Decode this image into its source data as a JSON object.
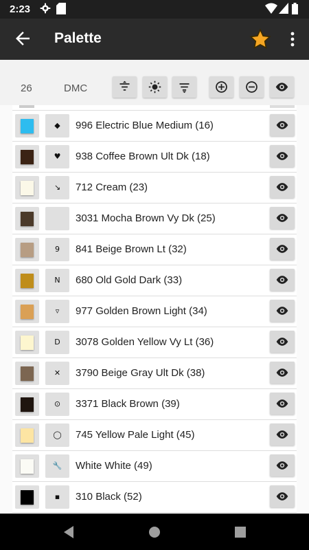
{
  "status_bar": {
    "time": "2:23",
    "icons": [
      "gear-icon",
      "sd-card-icon",
      "wifi-icon",
      "signal-icon",
      "battery-icon"
    ]
  },
  "app_bar": {
    "title": "Palette",
    "icons": [
      "back-arrow-icon",
      "star-icon",
      "more-vert-icon"
    ],
    "colors": {
      "background": "#2b2b2b",
      "star": "#f5a623"
    }
  },
  "toolbar": {
    "count": "26",
    "brand": "DMC",
    "buttons": [
      "sort-icon",
      "brightness-icon",
      "filter-icon",
      "zoom-in-icon",
      "zoom-out-icon",
      "eye-icon"
    ]
  },
  "colors": [
    {
      "swatch": "#2ebcef",
      "symbol": "◆",
      "label": "996 Electric Blue Medium",
      "count": "(16)"
    },
    {
      "swatch": "#3b2314",
      "symbol": "♥",
      "label": "938 Coffee Brown Ult Dk",
      "count": "(18)"
    },
    {
      "swatch": "#fbf8e8",
      "symbol": "↘",
      "label": "712 Cream",
      "count": "(23)"
    },
    {
      "swatch": "#4b3a2a",
      "symbol": "",
      "label": "3031 Mocha Brown Vy Dk",
      "count": "(25)"
    },
    {
      "swatch": "#b79d83",
      "symbol": "9",
      "label": "841 Beige Brown Lt",
      "count": "(32)"
    },
    {
      "swatch": "#bf8d1a",
      "symbol": "N",
      "label": "680 Old Gold Dark",
      "count": "(33)"
    },
    {
      "swatch": "#daa055",
      "symbol": "▿",
      "label": "977 Golden Brown Light",
      "count": "(34)"
    },
    {
      "swatch": "#fdf6cf",
      "symbol": "D",
      "label": "3078 Golden Yellow Vy Lt",
      "count": "(36)"
    },
    {
      "swatch": "#7c6651",
      "symbol": "✕",
      "label": "3790 Beige Gray Ult Dk",
      "count": "(38)"
    },
    {
      "swatch": "#1f150f",
      "symbol": "⊙",
      "label": "3371 Black Brown",
      "count": "(39)"
    },
    {
      "swatch": "#fde5a3",
      "symbol": "◯",
      "label": "745 Yellow Pale Light",
      "count": "(45)"
    },
    {
      "swatch": "#fbfbf5",
      "symbol": "🔧",
      "label": "White White",
      "count": "(49)"
    },
    {
      "swatch": "#000000",
      "symbol": "▪",
      "label": "310 Black",
      "count": "(52)"
    }
  ],
  "nav_bar": {
    "icons": [
      "back-triangle-icon",
      "home-circle-icon",
      "recents-square-icon"
    ]
  }
}
